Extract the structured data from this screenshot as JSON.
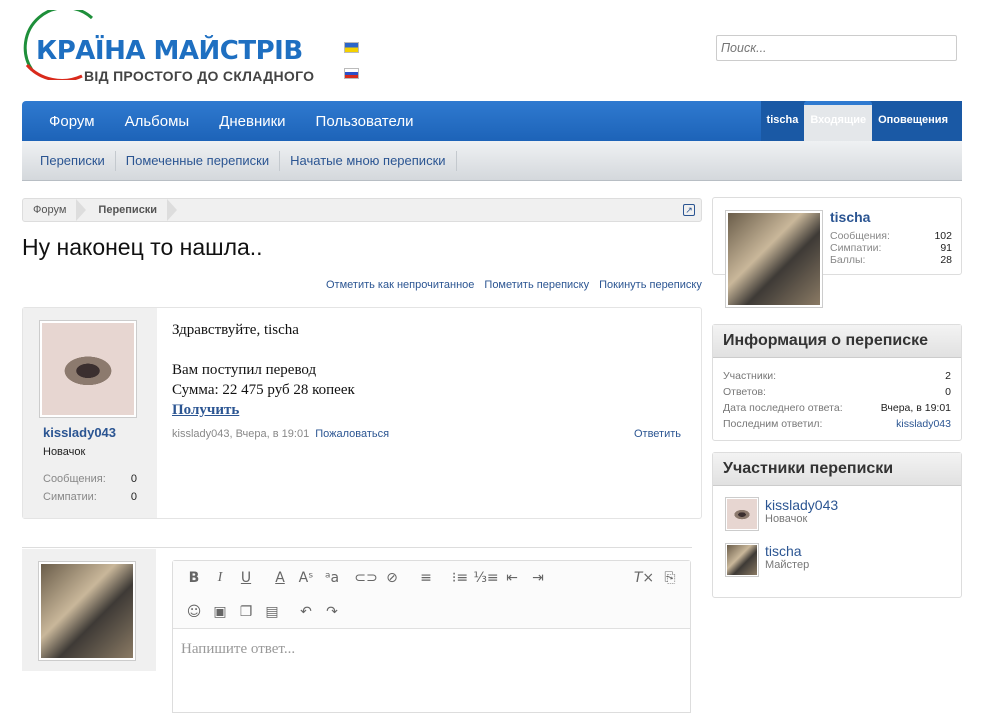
{
  "header": {
    "logo_main": "КРАЇНА МАЙСТРІВ",
    "logo_sub": "ВІД ПРОСТОГО ДО СКЛАДНОГО",
    "search_placeholder": "Поиск..."
  },
  "nav": {
    "tabs": [
      "Форум",
      "Альбомы",
      "Дневники",
      "Пользователи"
    ],
    "visitor_name": "tischa",
    "inbox": "Входящие",
    "alerts": "Оповещения"
  },
  "subnav": [
    "Переписки",
    "Помеченные переписки",
    "Начатые мною переписки"
  ],
  "breadcrumb": [
    "Форум",
    "Переписки"
  ],
  "title": "Ну наконец то нашла..",
  "actions": [
    "Отметить как непрочитанное",
    "Пометить переписку",
    "Покинуть переписку"
  ],
  "message": {
    "author": "kisslady043",
    "author_title": "Новачок",
    "stats": [
      {
        "label": "Сообщения:",
        "value": "0"
      },
      {
        "label": "Симпатии:",
        "value": "0"
      }
    ],
    "lines": [
      "Здравствуйте, tischa",
      "",
      "Вам поступил перевод",
      "Сумма: 22 475 руб 28 копеек"
    ],
    "link": "Получить",
    "meta": "kisslady043, Вчера, в 19:01",
    "report": "Пожаловаться",
    "reply": "Ответить"
  },
  "editor": {
    "placeholder": "Напишите ответ..."
  },
  "sidebar": {
    "visitor": {
      "name": "tischa",
      "stats": [
        {
          "label": "Сообщения:",
          "value": "102"
        },
        {
          "label": "Симпатии:",
          "value": "91"
        },
        {
          "label": "Баллы:",
          "value": "28"
        }
      ]
    },
    "info": {
      "title": "Информация о переписке",
      "rows": [
        {
          "label": "Участники:",
          "value": "2"
        },
        {
          "label": "Ответов:",
          "value": "0"
        },
        {
          "label": "Дата последнего ответа:",
          "value": "Вчера, в 19:01"
        },
        {
          "label": "Последним ответил:",
          "value": "kisslady043"
        }
      ]
    },
    "participants": {
      "title": "Участники переписки",
      "list": [
        {
          "name": "kisslady043",
          "title": "Новачок"
        },
        {
          "name": "tischa",
          "title": "Майстер"
        }
      ]
    }
  },
  "colors": {
    "nav": "#2f7ad0",
    "link": "#2b5592",
    "logo": "#1e6fc1"
  }
}
